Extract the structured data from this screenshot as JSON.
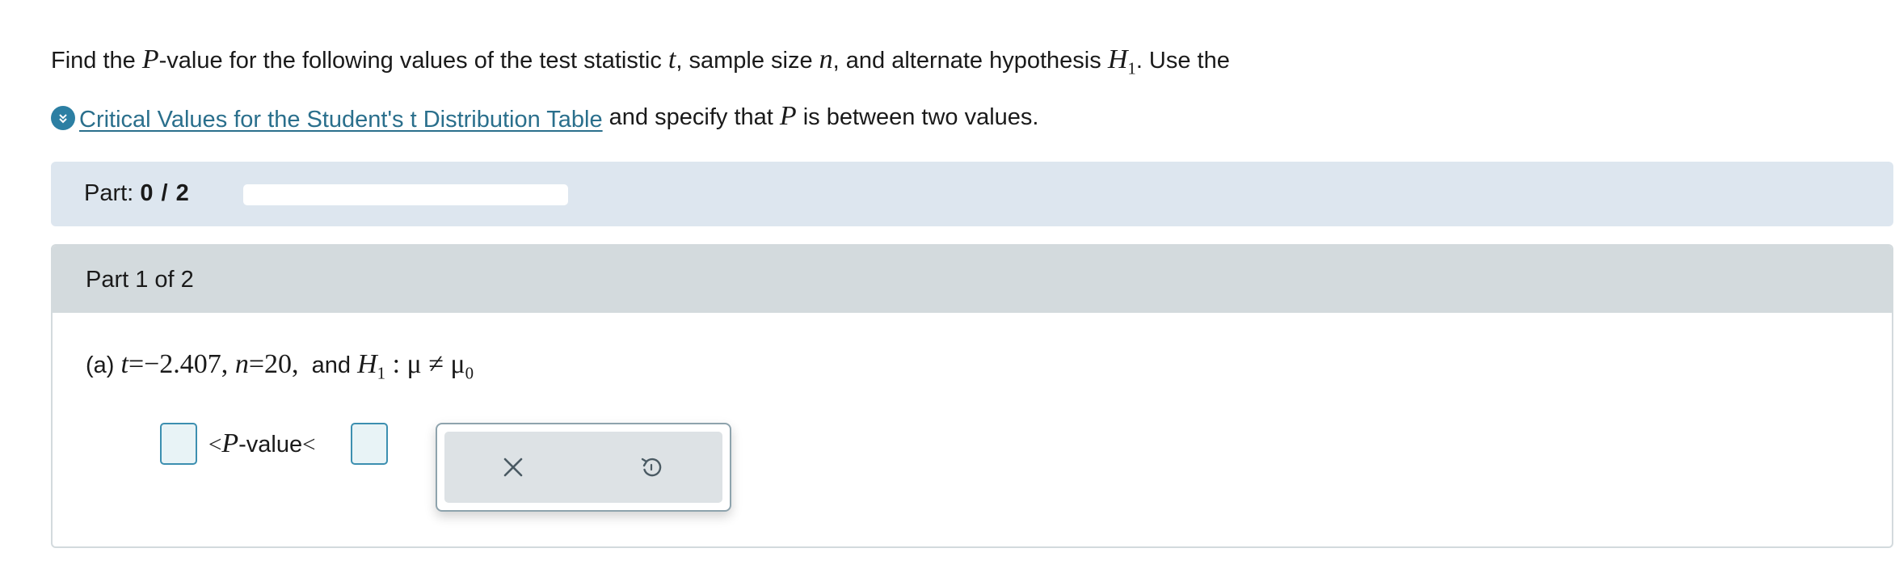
{
  "prompt": {
    "line1_part1": "Find the ",
    "P": "P",
    "line1_part2": "-value for the following values of the test statistic ",
    "t": "t",
    "line1_part3": ", sample size ",
    "n": "n",
    "line1_part4": ", and alternate hypothesis ",
    "H": "H",
    "H_sub": "1",
    "line1_part5": ". Use the",
    "link_text": "Critical Values for the Student's t Distribution Table",
    "line2_part1": " and specify that ",
    "line2_part2": " is between two values."
  },
  "progress": {
    "label": "Part:",
    "value": "0 / 2",
    "fraction": 0
  },
  "part": {
    "header": "Part 1 of 2",
    "question_prefix": "(a) ",
    "t_expr": "t",
    "t_eq": "=−2.407, ",
    "n_expr": "n",
    "n_eq": "=20,",
    "and_text": "  and ",
    "H": "H",
    "H_sub": "1",
    "hyp_rest": " : μ ≠ μ",
    "mu_sub": "0"
  },
  "answer": {
    "lt1": "<",
    "P": "P",
    "pvalue_suffix": "-value",
    "lt2": "<",
    "lower_value": "",
    "upper_value": ""
  },
  "tools": {
    "clear_icon": "close-icon",
    "undo_icon": "undo-icon"
  },
  "colors": {
    "accent": "#2c7fa3",
    "link": "#2a6f8c",
    "part_bar_bg": "#dde6ef",
    "part_header_bg": "#d3dadd"
  }
}
